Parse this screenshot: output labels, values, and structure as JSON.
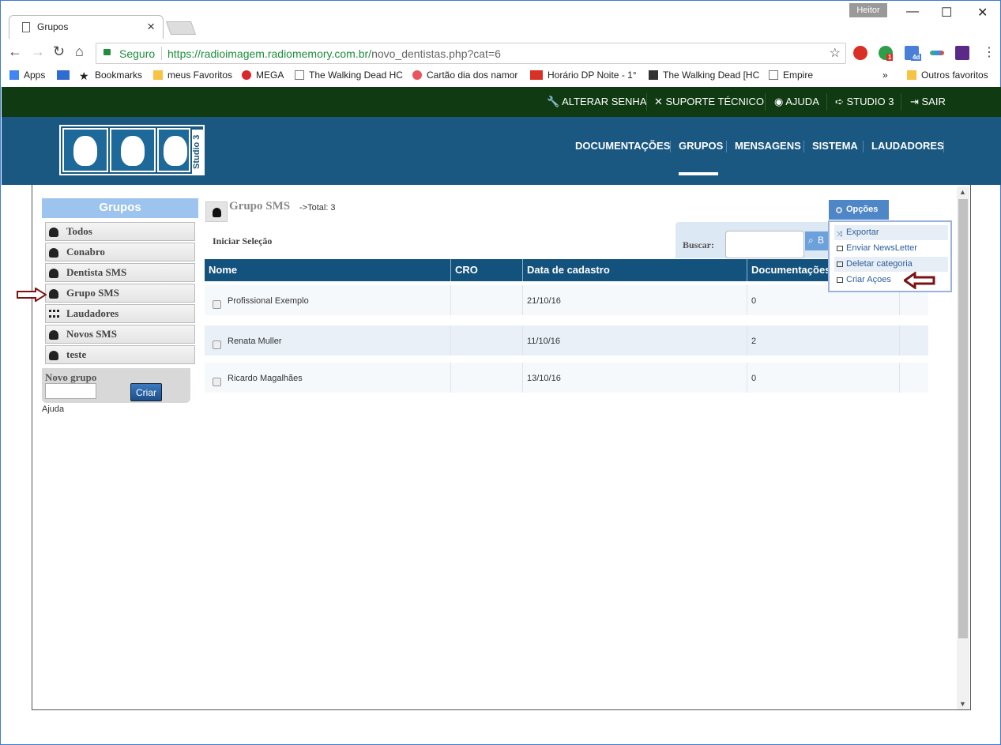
{
  "browser": {
    "tab_title": "Grupos",
    "user": "Heitor",
    "secure_label": "Seguro",
    "url_host": "https://radioimagem.radiomemory.com.br/",
    "url_path": "novo_dentistas.php?cat=6",
    "bookmarks": [
      {
        "label": "Apps",
        "icon": "apps-grid-icon",
        "color": "#4285f4"
      },
      {
        "label": "",
        "icon": "calendar-23-icon",
        "color": "#2e6cd1"
      },
      {
        "label": "Bookmarks",
        "icon": "star-icon",
        "color": "#444"
      },
      {
        "label": "meus Favoritos",
        "icon": "folder-icon",
        "color": "#f6c343"
      },
      {
        "label": "MEGA",
        "icon": "mega-icon",
        "color": "#d9272e"
      },
      {
        "label": "The Walking Dead HC",
        "icon": "page-icon",
        "color": "#777"
      },
      {
        "label": "Cartão dia dos namor",
        "icon": "heart-icon",
        "color": "#e8555e"
      },
      {
        "label": "Horário DP Noite - 1°",
        "icon": "pdf-icon",
        "color": "#d93025"
      },
      {
        "label": "The Walking Dead [HC",
        "icon": "figure-icon",
        "color": "#333"
      },
      {
        "label": "Empire",
        "icon": "page-icon",
        "color": "#777"
      }
    ],
    "other_bookmarks": "Outros favoritos",
    "ext_badge_1": "1",
    "ext_badge_2": "4d"
  },
  "topbar": {
    "links": [
      "ALTERAR SENHA",
      "SUPORTE TÉCNICO",
      "AJUDA",
      "STUDIO 3",
      "SAIR"
    ]
  },
  "logo": {
    "studio_text": "Studio 3"
  },
  "main_menu": [
    "DOCUMENTAÇÕES",
    "GRUPOS",
    "MENSAGENS",
    "SISTEMA",
    "LAUDADORES"
  ],
  "active_menu": "GRUPOS",
  "sidebar": {
    "title": "Grupos",
    "groups": [
      "Todos",
      "Conabro",
      "Dentista SMS",
      "Grupo SMS",
      "Laudadores",
      "Novos SMS",
      "teste"
    ],
    "new_group_label": "Novo grupo",
    "create_button": "Criar",
    "help_link": "Ajuda"
  },
  "content": {
    "group_name": "Grupo SMS",
    "total_label": "->Total: 3",
    "start_selection": "Iniciar Seleção",
    "search_label": "Buscar:",
    "search_button": "B"
  },
  "table": {
    "headers": [
      "Nome",
      "CRO",
      "Data de cadastro",
      "Documentações"
    ],
    "rows": [
      {
        "name": "Profissional Exemplo",
        "cro": "",
        "date": "21/10/16",
        "docs": "0"
      },
      {
        "name": "Renata Muller",
        "cro": "",
        "date": "11/10/16",
        "docs": "2"
      },
      {
        "name": "Ricardo Magalhães",
        "cro": "",
        "date": "13/10/16",
        "docs": "0"
      }
    ]
  },
  "options": {
    "button": "Opções",
    "items": [
      "Exportar",
      "Enviar NewsLetter",
      "Deletar categoria",
      "Criar Açoes"
    ]
  },
  "colors": {
    "topbar": "#0f3a12",
    "header": "#1a5781",
    "table_header": "#14527e",
    "annotation_arrow": "#7a1414"
  }
}
